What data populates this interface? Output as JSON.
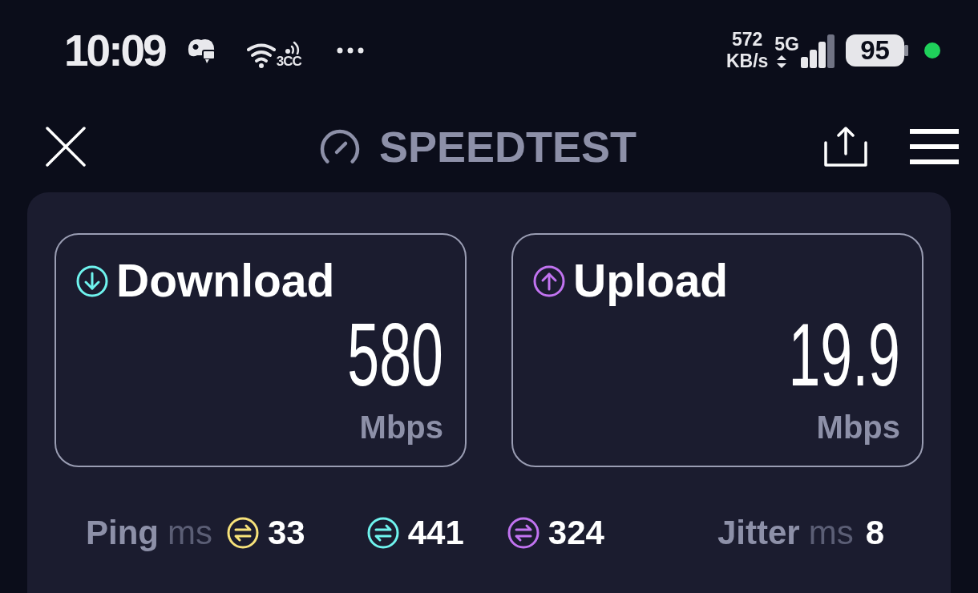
{
  "status_bar": {
    "time": "10:09",
    "network_label": "3CC",
    "data_rate": "572",
    "data_rate_unit": "KB/s",
    "network_type": "5G",
    "battery": "95"
  },
  "header": {
    "title": "SPEEDTEST"
  },
  "results": [
    {
      "kind": "download",
      "label": "Download",
      "value": "580",
      "unit": "Mbps",
      "color": "#6ff3ee"
    },
    {
      "kind": "upload",
      "label": "Upload",
      "value": "19.9",
      "unit": "Mbps",
      "color": "#c173f0"
    }
  ],
  "ping": {
    "label": "Ping",
    "unit": "ms",
    "readings": [
      {
        "value": "33",
        "color": "#f7e27a"
      },
      {
        "value": "441",
        "color": "#6ff3ee"
      },
      {
        "value": "324",
        "color": "#c173f0"
      }
    ]
  },
  "jitter": {
    "label": "Jitter",
    "unit": "ms",
    "value": "8"
  }
}
